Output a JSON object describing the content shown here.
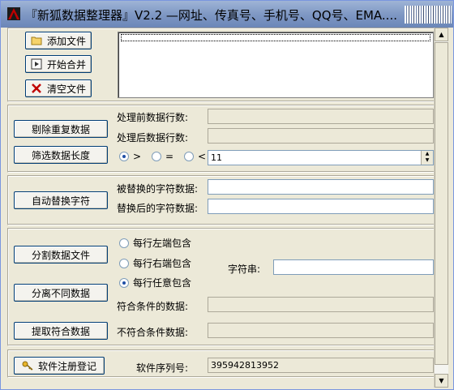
{
  "window": {
    "title": "『新狐数据整理器』V2.2 —网址、传真号、手机号、QQ号、EMA...."
  },
  "files": {
    "add_label": "添加文件",
    "merge_label": "开始合并",
    "clear_label": "清空文件"
  },
  "dedupe": {
    "button_label": "剔除重复数据",
    "before_label": "处理前数据行数:",
    "after_label": "处理后数据行数:",
    "before_value": "",
    "after_value": ""
  },
  "length_filter": {
    "button_label": "筛选数据长度",
    "options": [
      ">",
      "=",
      "<"
    ],
    "selected": ">",
    "value": "11"
  },
  "replace": {
    "button_label": "自动替换字符",
    "from_label": "被替换的字符数据:",
    "to_label": "替换后的字符数据:",
    "from_value": "",
    "to_value": ""
  },
  "split": {
    "split_label": "分割数据文件",
    "separate_label": "分离不同数据",
    "extract_label": "提取符合数据",
    "mode_options": [
      "每行左端包含",
      "每行右端包含",
      "每行任意包含"
    ],
    "selected_mode": "每行任意包含",
    "string_label": "字符串:",
    "string_value": "",
    "match_label": "符合条件的数据:",
    "nomatch_label": "不符合条件数据:",
    "match_value": "",
    "nomatch_value": ""
  },
  "register": {
    "button_label": "软件注册登记",
    "serial_label": "软件序列号:",
    "serial_value": "395942813952"
  },
  "icons": [
    "app-icon",
    "folder-icon",
    "play-icon",
    "delete-icon",
    "key-icon",
    "chevron-up-icon",
    "chevron-down-icon"
  ]
}
